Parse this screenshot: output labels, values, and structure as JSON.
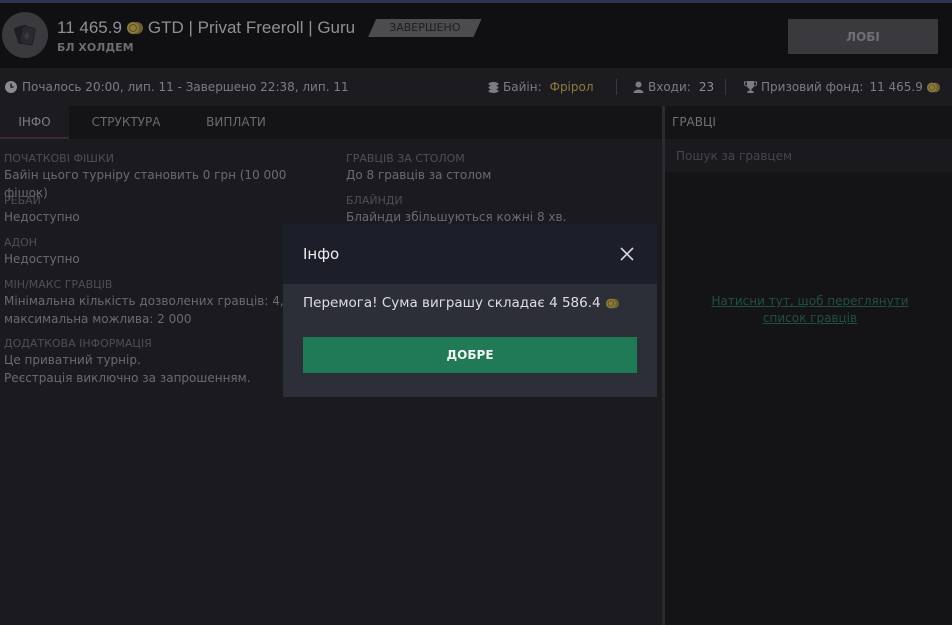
{
  "header": {
    "prize_amount": "11 465.9",
    "title": "GTD | Privat Freeroll | Guru",
    "status": "ЗАВЕРШЕНО",
    "subtitle": "БЛ ХОЛДЕМ",
    "lobby_label": "ЛОБІ"
  },
  "infobar": {
    "times": "Почалось 20:00, лип. 11  -  Завершено 22:38, лип. 11",
    "buyin_label": "Байін:",
    "buyin_value": "Фрірол",
    "entries_label": "Входи:",
    "entries_value": "23",
    "prize_label": "Призовий фонд:",
    "prize_value": "11 465.9"
  },
  "tabs": [
    "ІНФО",
    "СТРУКТУРА",
    "ВИПЛАТИ"
  ],
  "fields": {
    "chips_label": "ПОЧАТКОВІ ФІШКИ",
    "chips_value": "Байін цього турніру становить 0 грн (10 000 фішок)",
    "rebuy_label": "РЕБАЙ",
    "rebuy_value": "Недоступно",
    "addon_label": "АДОН",
    "addon_value": "Недоступно",
    "minmax_label": "МІН/МАКС ГРАВЦІВ",
    "minmax_value_1": "Мінімальна кількість дозволених гравців: 4,",
    "minmax_value_2": "максимальна можлива: 2 000",
    "extra_label": "ДОДАТКОВА ІНФОРМАЦІЯ",
    "extra_value_1": "Це приватний турнір.",
    "extra_value_2": "Реєстрація виключно за запрошенням.",
    "table_label": "ГРАВЦІВ ЗА СТОЛОМ",
    "table_value": "До 8 гравців за столом",
    "blinds_label": "БЛАЙНДИ",
    "blinds_value": "Блайнди збільшуються кожні 8 хв."
  },
  "players": {
    "title": "ГРАВЦІ",
    "search_placeholder": "Пошук за гравцем",
    "link_text": "Натисни тут, щоб переглянути список гравців"
  },
  "modal": {
    "title": "Інфо",
    "message": "Перемога! Сума виграшу складає 4 586.4",
    "ok_label": "ДОБРЕ"
  },
  "colors": {
    "accent_green": "#207a55",
    "gold": "#8e7a3c",
    "link": "#21503e"
  }
}
